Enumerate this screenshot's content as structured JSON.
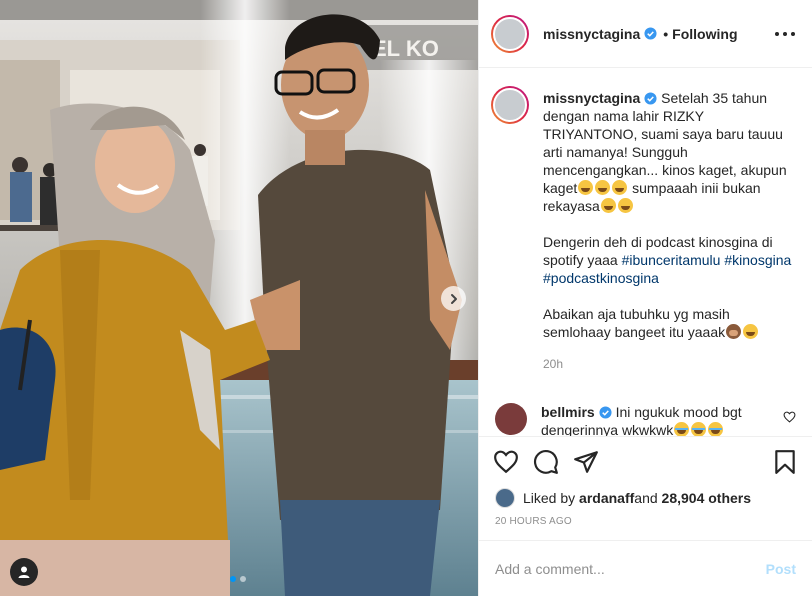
{
  "post": {
    "author": "missnyctagina",
    "header_follow_state": "Following",
    "photo_store_sign": "EL KO",
    "caption": {
      "username": "missnyctagina",
      "paragraph_1": "Setelah 35 tahun dengan nama lahir RIZKY TRIYANTONO, suami saya baru tauuu arti namanya! Sungguh mencengangkan... kinos kaget, akupun kaget",
      "paragraph_1_tail": " sumpaaah inii bukan rekayasa",
      "paragraph_2_text": "Dengerin deh di podcast kinosgina di spotify yaaa ",
      "hashtags": [
        "#ibunceritamulu",
        "#kinosgina",
        "#podcastkinosgina"
      ],
      "paragraph_3": "Abaikan aja tubuhku yg masih semlohaay bangeet itu yaaak",
      "time": "20h"
    },
    "reply": {
      "username": "bellmirs",
      "text": "Ini ngukuk mood bgt dengerinnya wkwkwk"
    },
    "likes": {
      "prefix": "Liked by ",
      "user": "ardanaff",
      "middle": " and ",
      "count": "28,904 others"
    },
    "timestamp": "20 HOURS AGO",
    "comment_input": {
      "placeholder": "Add a comment..."
    },
    "post_button": "Post"
  },
  "colors": {
    "accent": "#0095f6",
    "verified": "#3897f0",
    "post_disabled": "#b2dffc"
  },
  "icons": [
    "next-arrow-icon",
    "user-tag-icon",
    "verified-icon",
    "more-icon",
    "heart-icon",
    "comment-icon",
    "share-icon",
    "bookmark-icon"
  ]
}
